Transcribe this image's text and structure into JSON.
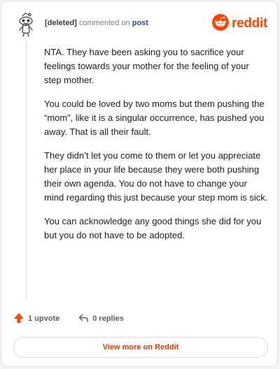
{
  "header": {
    "username": "[deleted]",
    "commented_on": "commented on",
    "post_link": "post",
    "brand": "reddit"
  },
  "comment": {
    "paragraphs": [
      "NTA. They have been asking you to sacrifice your feelings towards your mother for the feeling of your step mother.",
      "You could be loved by two moms but them pushing the “mom”, like it is a singular occurrence, has pushed you away. That is all their fault.",
      "They didn’t let you come to them or let you appreciate her place in your life because they were both pushing their own agenda. You do not have to change your mind regarding this just because your step mom is sick.",
      "You can acknowledge any good things she did for you but you do not have to be adopted."
    ]
  },
  "actions": {
    "upvote_label": "1 upvote",
    "replies_label": "0 replies"
  },
  "footer": {
    "view_more_label": "View more on Reddit"
  },
  "colors": {
    "brand": "#ff4500",
    "link": "#1f4fa8",
    "view_more": "#d93a00"
  },
  "icons": {
    "avatar": "snoo-avatar",
    "brand": "reddit-logo-icon",
    "upvote": "upvote-arrow-icon",
    "reply": "reply-arrow-icon"
  }
}
